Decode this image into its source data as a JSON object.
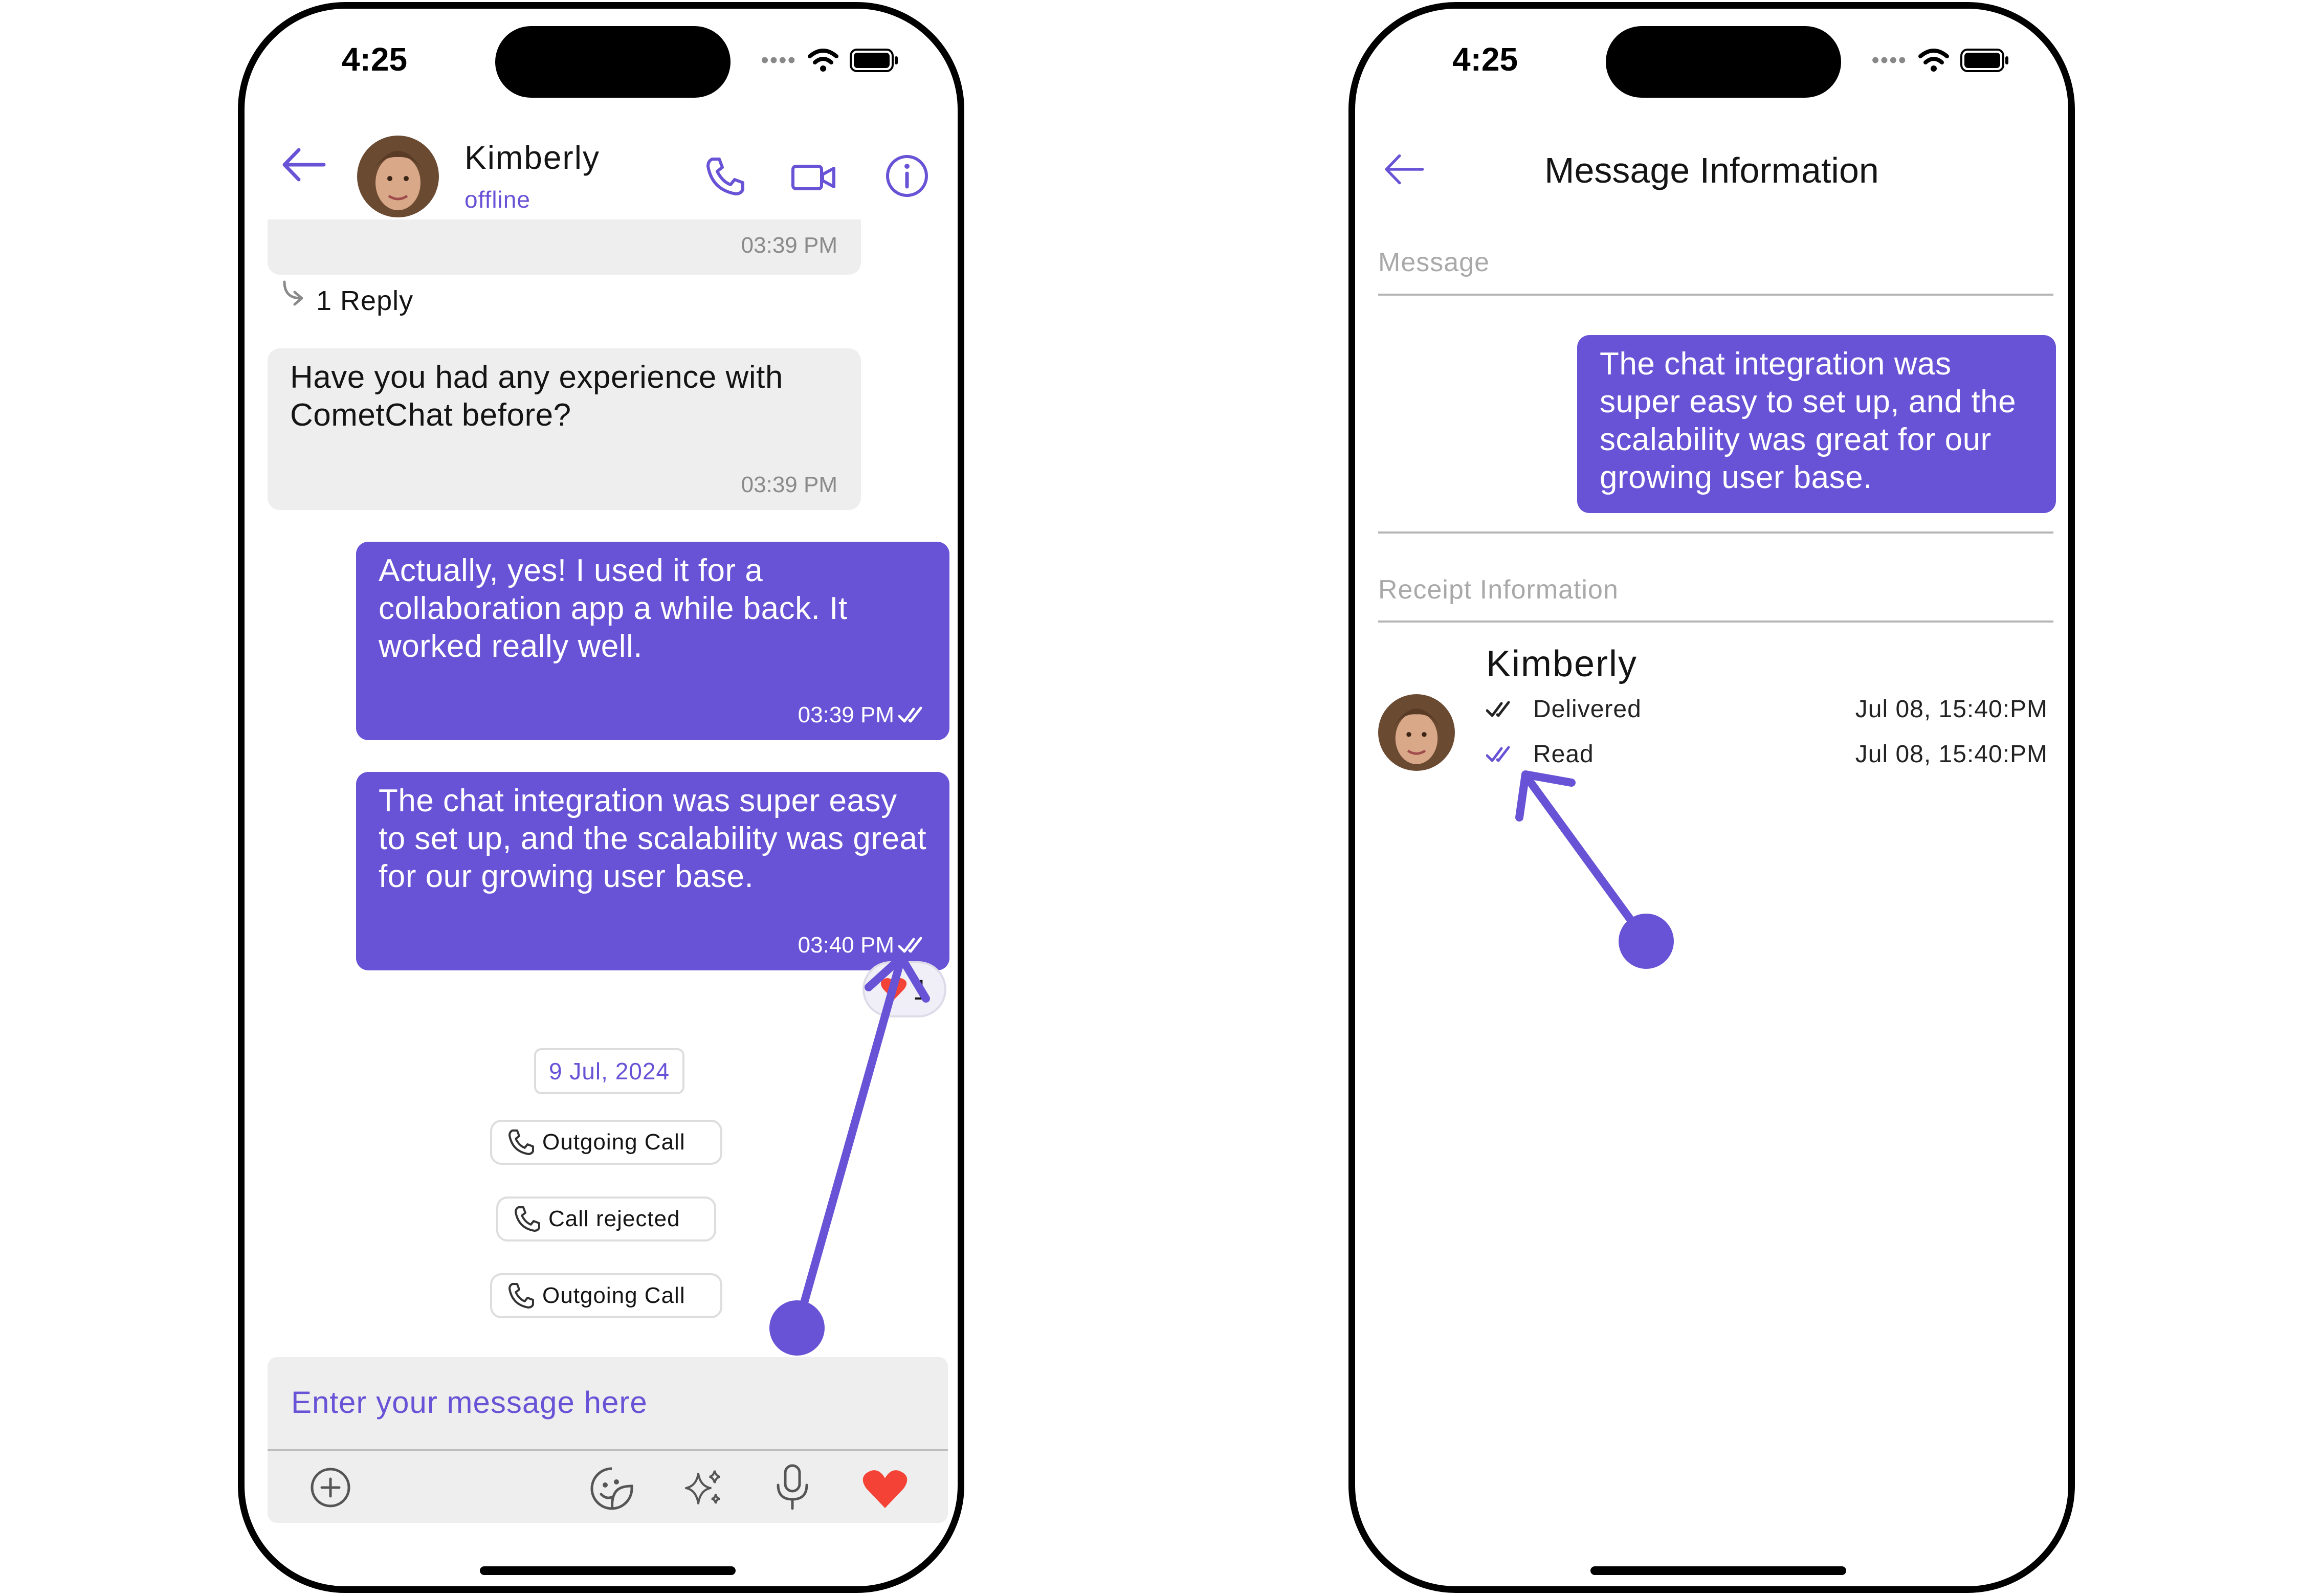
{
  "left_screen": {
    "status_time": "4:25",
    "header": {
      "name": "Kimberly",
      "status": "offline"
    },
    "top_partial_time": "03:39 PM",
    "reply_count": "1 Reply",
    "messages": [
      {
        "direction": "incoming",
        "text": "Have you had any experience with CometChat before?",
        "time": "03:39 PM"
      },
      {
        "direction": "outgoing",
        "text": "Actually, yes!  I used it for a collaboration app a while back.  It worked really well.",
        "time": "03:39 PM"
      },
      {
        "direction": "outgoing",
        "text": "The chat integration was super easy to set up, and the scalability was great for our growing user base.",
        "time": "03:40 PM"
      }
    ],
    "reaction_count": "1",
    "date_separator": "9 Jul, 2024",
    "calls": [
      "Outgoing Call",
      "Call rejected",
      "Outgoing Call"
    ],
    "composer": {
      "placeholder": "Enter your message here"
    }
  },
  "right_screen": {
    "status_time": "4:25",
    "title": "Message Information",
    "message_label": "Message",
    "message_text": "The chat integration was super easy to set up, and the scalability was great for our growing user base.",
    "receipt_label": "Receipt Information",
    "receipt": {
      "name": "Kimberly",
      "delivered_label": "Delivered",
      "delivered_time": "Jul 08, 15:40:PM",
      "read_label": "Read",
      "read_time": "Jul 08, 15:40:PM"
    }
  },
  "colors": {
    "accent": "#6852d6",
    "incoming_bubble": "#eeeeee",
    "heart": "#f44336"
  },
  "icons": [
    "back-arrow-icon",
    "voice-call-icon",
    "video-call-icon",
    "info-icon",
    "reply-arrow-icon",
    "double-check-icon",
    "phone-icon",
    "add-icon",
    "sticker-icon",
    "ai-sparkle-icon",
    "microphone-icon",
    "heart-icon"
  ]
}
